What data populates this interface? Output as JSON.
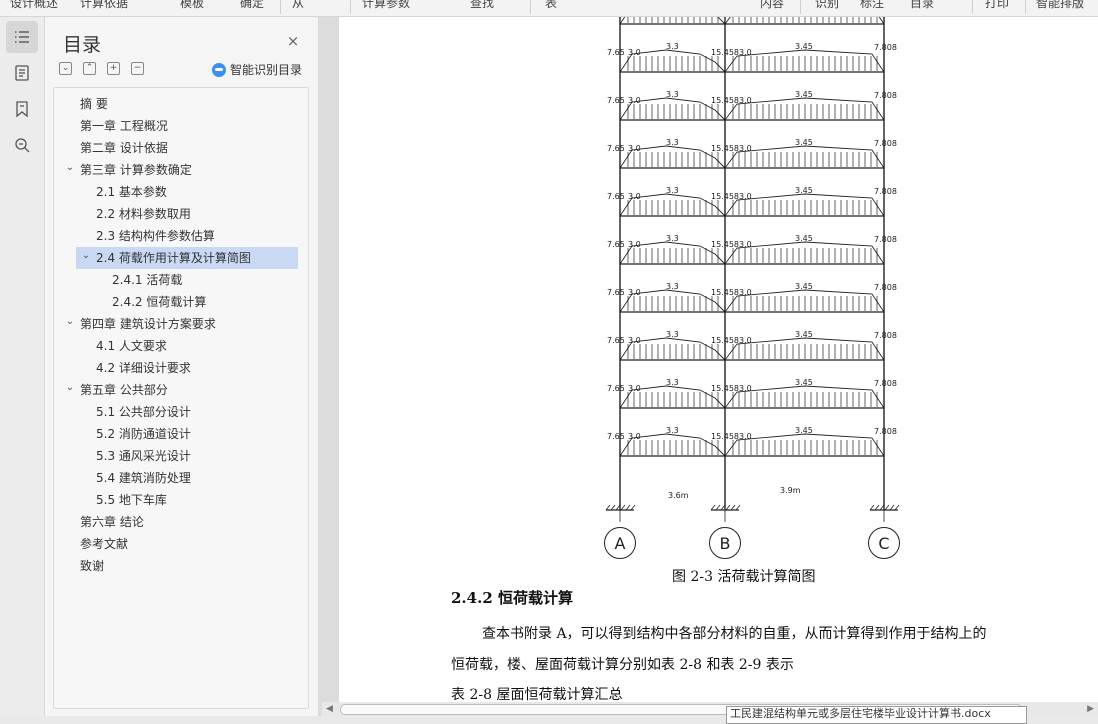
{
  "topbar": {
    "items": [
      "设计概述",
      "计算依据",
      "模板",
      "确定",
      "从",
      "计算参数",
      "查找",
      "表",
      "内容",
      "识别",
      "标注",
      "目录",
      "打印",
      "智能排版"
    ]
  },
  "rail": {
    "buttons": [
      {
        "name": "toc-icon",
        "active": true
      },
      {
        "name": "page-outline-icon",
        "active": false
      },
      {
        "name": "bookmark-icon",
        "active": false
      },
      {
        "name": "search-document-icon",
        "active": false
      }
    ]
  },
  "toc": {
    "title": "目录",
    "close_label": "×",
    "tools": [
      "⌄",
      "⌃",
      "+",
      "−"
    ],
    "smart_label": "智能识别目录",
    "items": [
      {
        "label": "摘  要",
        "level": 0,
        "chevron": ""
      },
      {
        "label": "第一章  工程概况",
        "level": 0,
        "chevron": ""
      },
      {
        "label": "第二章  设计依据",
        "level": 0,
        "chevron": ""
      },
      {
        "label": "第三章  计算参数确定",
        "level": 0,
        "chevron": "v"
      },
      {
        "label": "2.1  基本参数",
        "level": 1,
        "chevron": ""
      },
      {
        "label": "2.2  材料参数取用",
        "level": 1,
        "chevron": ""
      },
      {
        "label": "2.3  结构构件参数估算",
        "level": 1,
        "chevron": ""
      },
      {
        "label": "2.4  荷载作用计算及计算简图",
        "level": 1,
        "chevron": "v",
        "selected": true
      },
      {
        "label": "2.4.1  活荷载",
        "level": 2,
        "chevron": ""
      },
      {
        "label": "2.4.2  恒荷载计算",
        "level": 2,
        "chevron": ""
      },
      {
        "label": "第四章  建筑设计方案要求",
        "level": 0,
        "chevron": "v"
      },
      {
        "label": "4.1 人文要求",
        "level": 1,
        "chevron": ""
      },
      {
        "label": "4.2 详细设计要求",
        "level": 1,
        "chevron": ""
      },
      {
        "label": "第五章  公共部分",
        "level": 0,
        "chevron": "v"
      },
      {
        "label": "5.1 公共部分设计",
        "level": 1,
        "chevron": ""
      },
      {
        "label": "5.2 消防通道设计",
        "level": 1,
        "chevron": ""
      },
      {
        "label": "5.3 通风采光设计",
        "level": 1,
        "chevron": ""
      },
      {
        "label": "5.4 建筑消防处理",
        "level": 1,
        "chevron": ""
      },
      {
        "label": "5.5 地下车库",
        "level": 1,
        "chevron": ""
      },
      {
        "label": "第六章  结论",
        "level": 0,
        "chevron": ""
      },
      {
        "label": "参考文献",
        "level": 0,
        "chevron": ""
      },
      {
        "label": "致谢",
        "level": 0,
        "chevron": ""
      }
    ]
  },
  "diagram": {
    "floor_labels": {
      "left_end": "7.65",
      "left_start": "3.0",
      "left_peak": "3.3",
      "mid": "15.458",
      "right_start": "3.0",
      "right_peak": "3.45",
      "right_end": "7.808"
    },
    "floor_count": 9,
    "span_left": "3.6m",
    "span_right": "3.9m",
    "axes": [
      "A",
      "B",
      "C"
    ]
  },
  "doc": {
    "caption": "图 2-3  活荷载计算简图",
    "heading": "2.4.2  恒荷载计算",
    "para1": "查本书附录 A，可以得到结构中各部分材料的自重，从而计算得到作用于结构上的",
    "para2": "恒荷载，楼、屋面荷载计算分别如表 2-8 和表 2-9 表示",
    "table_title": "表 2-8   屋面恒荷载计算汇总"
  },
  "tooltip": "工民建混结构单元或多层住宅楼毕业设计计算书.docx",
  "colors": {
    "selected_bg": "#c9d9f3",
    "ai_blue": "#3b8ff0"
  }
}
